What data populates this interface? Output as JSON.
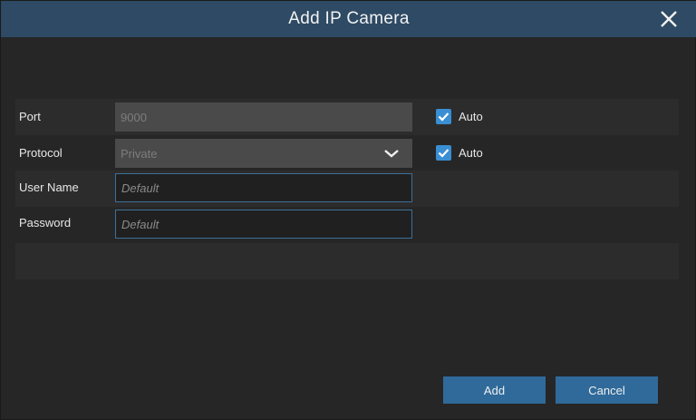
{
  "dialog": {
    "title": "Add IP Camera",
    "close_icon": "close-icon"
  },
  "form": {
    "port": {
      "label": "Port",
      "value": "9000",
      "auto_label": "Auto",
      "auto_checked": true
    },
    "protocol": {
      "label": "Protocol",
      "value": "Private",
      "auto_label": "Auto",
      "auto_checked": true
    },
    "username": {
      "label": "User Name",
      "placeholder": "Default"
    },
    "password": {
      "label": "Password",
      "placeholder": "Default"
    }
  },
  "buttons": {
    "add_label": "Add",
    "cancel_label": "Cancel"
  },
  "colors": {
    "titlebar": "#2e4a64",
    "accent": "#3a8ed3",
    "button": "#2f6a9a"
  }
}
